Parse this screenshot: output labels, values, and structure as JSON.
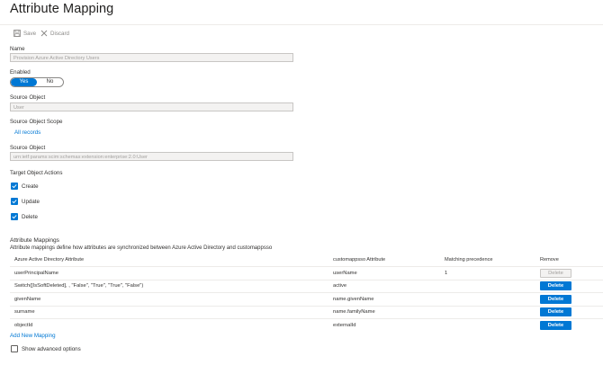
{
  "header": {
    "title": "Attribute Mapping",
    "more_label": "···"
  },
  "toolbar": {
    "save_label": "Save",
    "discard_label": "Discard"
  },
  "form": {
    "name_label": "Name",
    "name_value": "Provision Azure Active Directory Users",
    "enabled_label": "Enabled",
    "enabled_options": [
      "Yes",
      "No"
    ],
    "enabled_selected": "Yes",
    "source_object_label": "Source Object",
    "source_object_value": "User",
    "source_object_scope_label": "Source Object Scope",
    "source_object_scope_link": "All records",
    "target_object_label": "Source Object",
    "target_object_value": "urn:ietf:params:scim:schemas:extension:enterprise:2.0:User",
    "target_actions_label": "Target Object Actions",
    "actions": [
      {
        "label": "Create",
        "checked": true
      },
      {
        "label": "Update",
        "checked": true
      },
      {
        "label": "Delete",
        "checked": true
      }
    ]
  },
  "mappings": {
    "title": "Attribute Mappings",
    "description": "Attribute mappings define how attributes are synchronized between Azure Active Directory and customappsso",
    "columns": [
      "Azure Active Directory Attribute",
      "customappsso Attribute",
      "Matching precedence",
      "Remove"
    ],
    "rows": [
      {
        "source": "userPrincipalName",
        "target": "userName",
        "precedence": "1",
        "remove_label": "Delete",
        "remove_disabled": true
      },
      {
        "source": "Switch([IsSoftDeleted], , \"False\", \"True\", \"True\", \"False\")",
        "target": "active",
        "precedence": "",
        "remove_label": "Delete",
        "remove_disabled": false
      },
      {
        "source": "givenName",
        "target": "name.givenName",
        "precedence": "",
        "remove_label": "Delete",
        "remove_disabled": false
      },
      {
        "source": "surname",
        "target": "name.familyName",
        "precedence": "",
        "remove_label": "Delete",
        "remove_disabled": false
      },
      {
        "source": "objectId",
        "target": "externalId",
        "precedence": "",
        "remove_label": "Delete",
        "remove_disabled": false
      }
    ],
    "add_new_label": "Add New Mapping",
    "advanced_label": "Show advanced options",
    "advanced_checked": false
  },
  "colors": {
    "accent": "#0078d4",
    "border": "#c8c6c4",
    "readonly_bg": "#f3f2f1"
  }
}
